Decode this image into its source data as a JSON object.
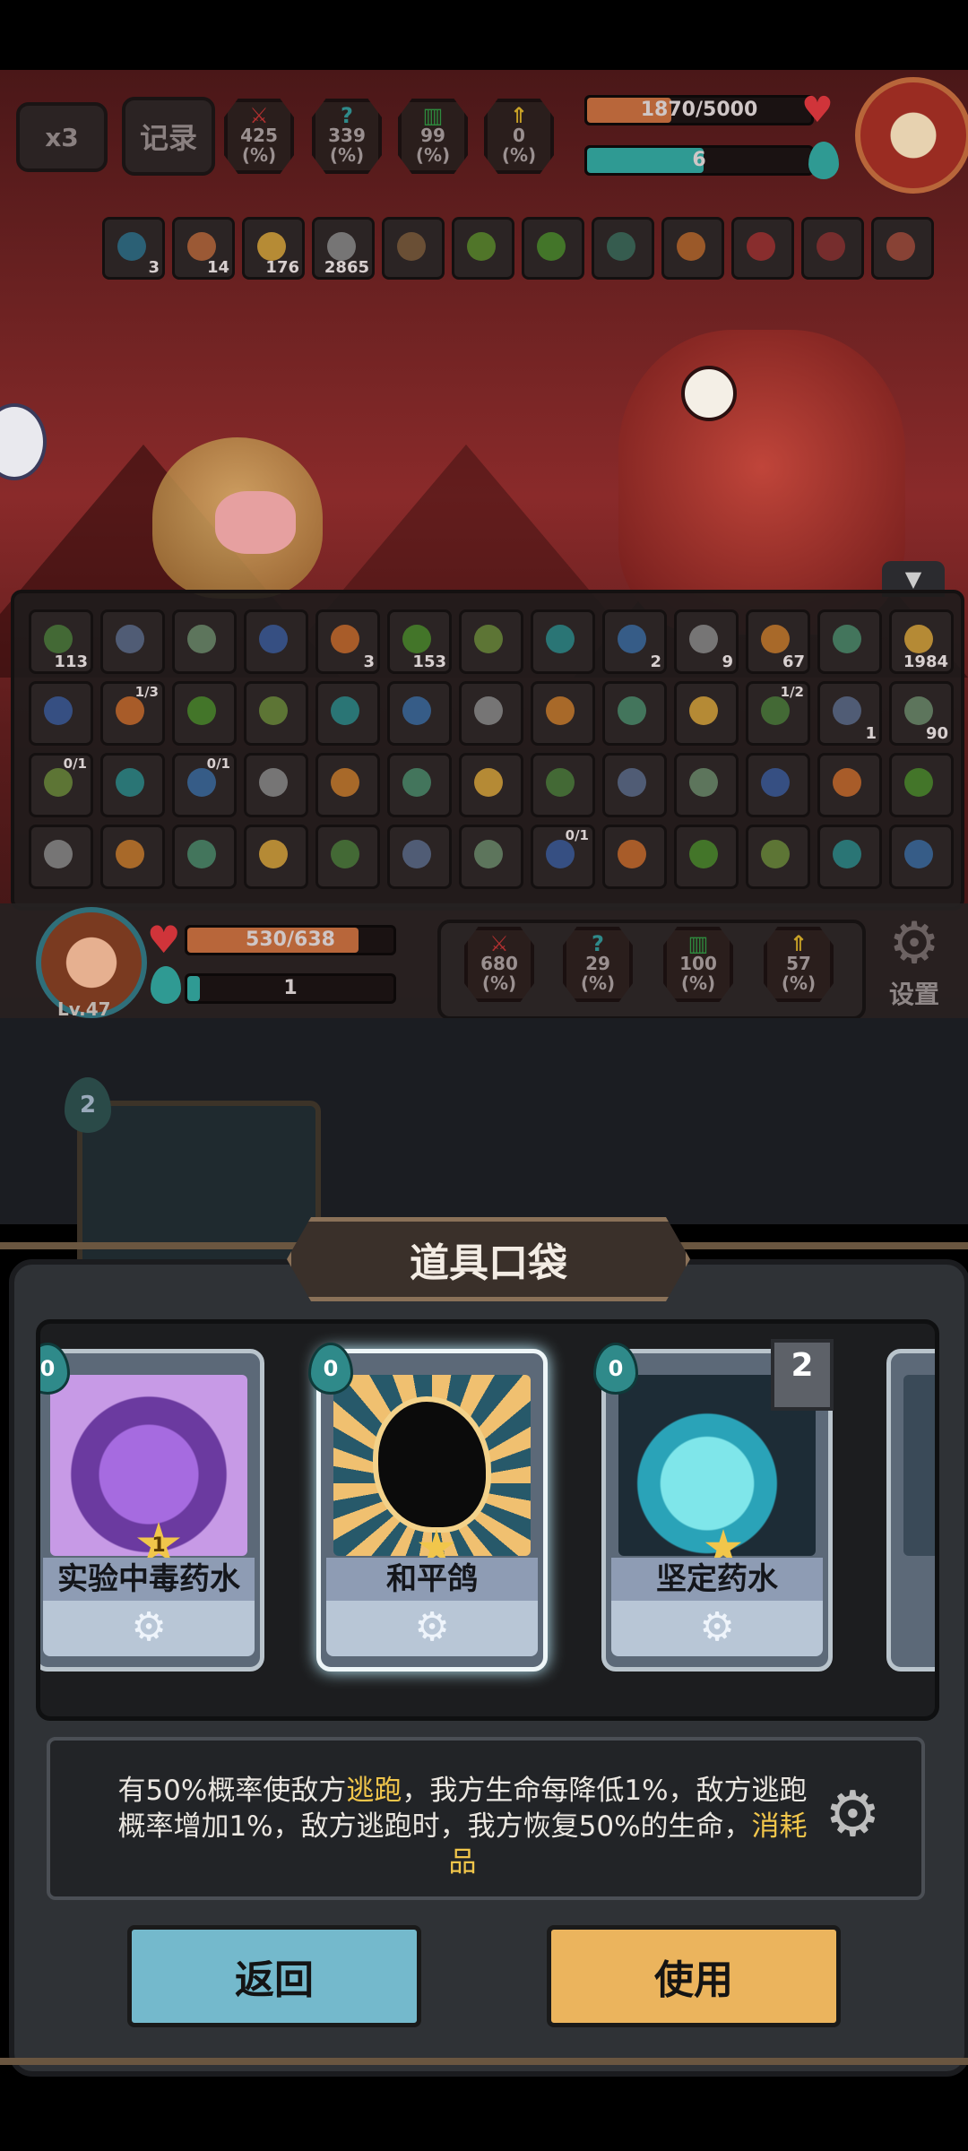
{
  "top": {
    "speed_label": "x3",
    "record_label": "记录",
    "stats": [
      {
        "value": "425",
        "unit": "(%)",
        "icon": "sword-icon",
        "color": "#c0392b"
      },
      {
        "value": "339",
        "unit": "(%)",
        "icon": "question-shield-icon",
        "color": "#2f8a8a"
      },
      {
        "value": "99",
        "unit": "(%)",
        "icon": "armor-icon",
        "color": "#2e8b3e"
      },
      {
        "value": "0",
        "unit": "(%)",
        "icon": "arrow-up-icon",
        "color": "#c9a227"
      }
    ],
    "enemy_hp": "1870/5000",
    "enemy_hp_fraction": 0.374,
    "enemy_energy": "6",
    "enemy_energy_fraction": 0.52
  },
  "enemy_effects": [
    "3",
    "14",
    "176",
    "2865",
    "",
    "",
    "",
    "",
    "",
    "",
    "",
    ""
  ],
  "inventory": {
    "row1": [
      "113",
      "",
      "",
      "",
      "3",
      "153",
      "",
      "",
      "2",
      "9",
      "67",
      "",
      "1984"
    ],
    "row2": [
      {
        "t": "",
        "n": ""
      },
      {
        "t": "1/3",
        "n": ""
      },
      {
        "t": "",
        "n": ""
      },
      {
        "t": "",
        "n": ""
      },
      {
        "t": "",
        "n": ""
      },
      {
        "t": "",
        "n": ""
      },
      {
        "t": "",
        "n": ""
      },
      {
        "t": "",
        "n": ""
      },
      {
        "t": "",
        "n": ""
      },
      {
        "t": "",
        "n": ""
      },
      {
        "t": "1/2",
        "n": ""
      },
      {
        "t": "",
        "n": "1"
      },
      {
        "t": "",
        "n": "90"
      }
    ],
    "row3": [
      {
        "t": "0/1"
      },
      {
        "t": ""
      },
      {
        "t": "0/1"
      },
      {
        "t": ""
      },
      {
        "t": ""
      },
      {
        "t": ""
      },
      {
        "t": ""
      },
      {
        "t": ""
      },
      {
        "t": ""
      },
      {
        "t": ""
      },
      {
        "t": ""
      },
      {
        "t": ""
      },
      {
        "t": ""
      }
    ],
    "row4": [
      {
        "t": ""
      },
      {
        "t": ""
      },
      {
        "t": ""
      },
      {
        "t": ""
      },
      {
        "t": ""
      },
      {
        "t": ""
      },
      {
        "t": ""
      },
      {
        "t": "0/1"
      },
      {
        "t": ""
      },
      {
        "t": ""
      },
      {
        "t": ""
      },
      {
        "t": ""
      },
      {
        "t": ""
      }
    ]
  },
  "player": {
    "level": "Lv.47",
    "hp": "530/638",
    "hp_fraction": 0.83,
    "energy": "1",
    "energy_fraction": 0.06,
    "stats": [
      {
        "value": "680",
        "unit": "(%)",
        "icon": "sword-icon"
      },
      {
        "value": "29",
        "unit": "(%)",
        "icon": "question-shield-icon"
      },
      {
        "value": "100",
        "unit": "(%)",
        "icon": "armor-icon"
      },
      {
        "value": "57",
        "unit": "(%)",
        "icon": "arrow-up-icon"
      }
    ],
    "settings_label": "设置"
  },
  "deck_cost": "2",
  "dialog": {
    "title": "道具口袋",
    "cards": [
      {
        "name": "实验中毒药水",
        "cost": "0",
        "star": "1",
        "art_color": "#8b4fc0",
        "icon": "poison-potion-icon"
      },
      {
        "name": "和平鸽",
        "cost": "0",
        "star": "",
        "art_color": "#d79a3c",
        "icon": "dove-icon"
      },
      {
        "name": "坚定药水",
        "cost": "0",
        "star": "",
        "stack": "2",
        "art_color": "#4ed0d8",
        "icon": "resolve-potion-icon"
      }
    ],
    "description_parts": [
      {
        "text": "有50%概率使敌方",
        "hl": false
      },
      {
        "text": "逃跑",
        "hl": true
      },
      {
        "text": "，我方生命每降低1%，敌方逃跑概率增加1%，敌方逃跑时，我方恢复50%的生命，",
        "hl": false
      },
      {
        "text": "消耗品",
        "hl": true
      }
    ],
    "back_label": "返回",
    "use_label": "使用",
    "back_color": "#74b9cc",
    "use_color": "#ebb45d"
  }
}
